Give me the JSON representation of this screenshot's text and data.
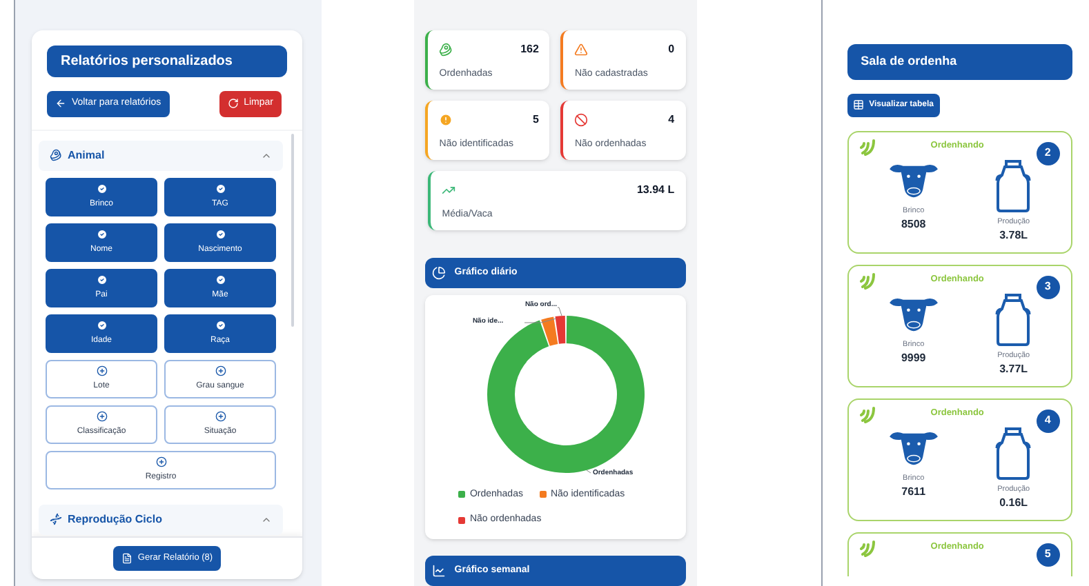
{
  "report_panel": {
    "title": "Relatórios personalizados",
    "back_button": "Voltar para relatórios",
    "clear_button": "Limpar",
    "sections": [
      {
        "title": "Animal",
        "expanded": true,
        "fields": [
          {
            "label": "Brinco",
            "selected": true
          },
          {
            "label": "TAG",
            "selected": true
          },
          {
            "label": "Nome",
            "selected": true
          },
          {
            "label": "Nascimento",
            "selected": true
          },
          {
            "label": "Pai",
            "selected": true
          },
          {
            "label": "Mãe",
            "selected": true
          },
          {
            "label": "Idade",
            "selected": true
          },
          {
            "label": "Raça",
            "selected": true
          },
          {
            "label": "Lote",
            "selected": false
          },
          {
            "label": "Grau sangue",
            "selected": false
          },
          {
            "label": "Classificação",
            "selected": false
          },
          {
            "label": "Situação",
            "selected": false
          },
          {
            "label": "Registro",
            "selected": false
          }
        ]
      },
      {
        "title": "Reprodução Ciclo",
        "expanded": true
      }
    ],
    "generate_button": "Gerar Relatório (8)"
  },
  "milking_stats": {
    "cards": [
      {
        "kind": "milked",
        "value": "162",
        "label": "Ordenhadas",
        "color": "#3cb04a"
      },
      {
        "kind": "unregistered",
        "value": "0",
        "label": "Não cadastradas",
        "color": "#f47b20"
      },
      {
        "kind": "unidentified",
        "value": "5",
        "label": "Não identificadas",
        "color": "#f5a623"
      },
      {
        "kind": "not_milked",
        "value": "4",
        "label": "Não ordenhadas",
        "color": "#e53935"
      },
      {
        "kind": "average",
        "value": "13.94 L",
        "label": "Média/Vaca",
        "color": "#3cb878"
      }
    ],
    "daily_chart": {
      "title": "Gráfico diário",
      "slice_labels": [
        "Não ide...",
        "Não ord...",
        "Ordenhadas"
      ],
      "chart_data": {
        "type": "donut",
        "categories": [
          "Ordenhadas",
          "Não identificadas",
          "Não ordenhadas"
        ],
        "values": [
          94.74,
          2.92,
          2.34
        ],
        "colors": [
          "#3cb04a",
          "#f47b20",
          "#e53935"
        ]
      }
    },
    "weekly_chart": {
      "title": "Gráfico semanal"
    }
  },
  "milking_parlor": {
    "title": "Sala de ordenha",
    "table_button": "Visualizar tabela",
    "stalls": [
      {
        "status": "Ordenhando",
        "number": "2",
        "brinco_label": "Brinco",
        "brinco": "8508",
        "production_label": "Produção",
        "production": "3.78L"
      },
      {
        "status": "Ordenhando",
        "number": "3",
        "brinco_label": "Brinco",
        "brinco": "9999",
        "production_label": "Produção",
        "production": "3.77L"
      },
      {
        "status": "Ordenhando",
        "number": "4",
        "brinco_label": "Brinco",
        "brinco": "7611",
        "production_label": "Produção",
        "production": "0.16L"
      },
      {
        "status": "Ordenhando",
        "number": "5"
      }
    ]
  }
}
